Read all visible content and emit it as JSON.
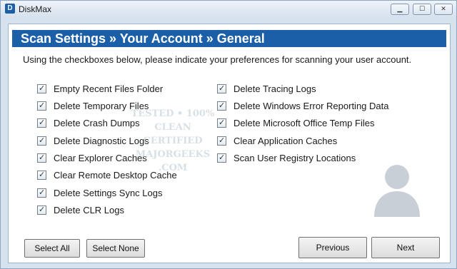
{
  "window": {
    "title": "DiskMax",
    "icon": "disk-icon"
  },
  "header": {
    "breadcrumb": "Scan Settings  »  Your Account » General"
  },
  "intro": "Using the checkboxes below, please indicate your preferences for scanning your user account.",
  "options_left": [
    {
      "label": "Empty Recent Files Folder",
      "checked": true
    },
    {
      "label": "Delete Temporary Files",
      "checked": true
    },
    {
      "label": "Delete Crash Dumps",
      "checked": true
    },
    {
      "label": "Delete Diagnostic Logs",
      "checked": true
    },
    {
      "label": "Clear Explorer Caches",
      "checked": true
    },
    {
      "label": "Clear Remote Desktop Cache",
      "checked": true
    },
    {
      "label": "Delete Settings Sync Logs",
      "checked": true
    },
    {
      "label": "Delete CLR Logs",
      "checked": true
    }
  ],
  "options_right": [
    {
      "label": "Delete Tracing Logs",
      "checked": true
    },
    {
      "label": "Delete Windows Error Reporting Data",
      "checked": true
    },
    {
      "label": "Delete Microsoft Office Temp Files",
      "checked": true
    },
    {
      "label": "Clear Application Caches",
      "checked": true
    },
    {
      "label": "Scan User Registry Locations",
      "checked": true
    }
  ],
  "buttons": {
    "select_all": "Select All",
    "select_none": "Select None",
    "previous": "Previous",
    "next": "Next"
  },
  "watermark": {
    "line1": "TESTED • 100% CLEAN",
    "line2": "CERTIFIED",
    "line3": "MAJORGEEKS",
    "line4": ".COM"
  },
  "colors": {
    "accent": "#1b5fa8",
    "background": "#d6e2ee"
  }
}
